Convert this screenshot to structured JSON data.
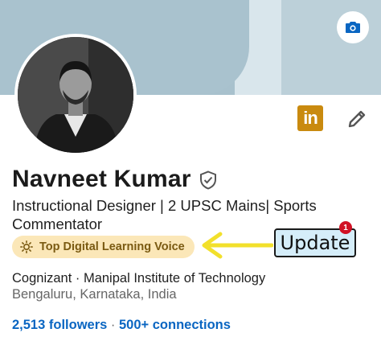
{
  "profile": {
    "name": "Navneet Kumar",
    "headline": "Instructional Designer | 2 UPSC Mains| Sports Commentator",
    "badge_label": "Top Digital Learning Voice",
    "company_education": "Cognizant · Manipal Institute of Technology",
    "location": "Bengaluru, Karnataka, India",
    "followers": "2,513 followers",
    "separator": "·",
    "connections": "500+ connections",
    "linkedin_logo_text": "in"
  },
  "annotation": {
    "update_label": "Update",
    "notification_count": "1"
  },
  "colors": {
    "link_blue": "#0a66c2",
    "badge_background": "#fbe7b8",
    "badge_text": "#7a5a12",
    "arrow_yellow": "#f2e02b",
    "linkedin_badge": "#c98a0f",
    "banner": "#a8c1cd"
  },
  "icons": {
    "camera": "camera-icon",
    "edit": "pencil-icon",
    "verified": "shield-check-icon",
    "badge": "sun-icon"
  }
}
